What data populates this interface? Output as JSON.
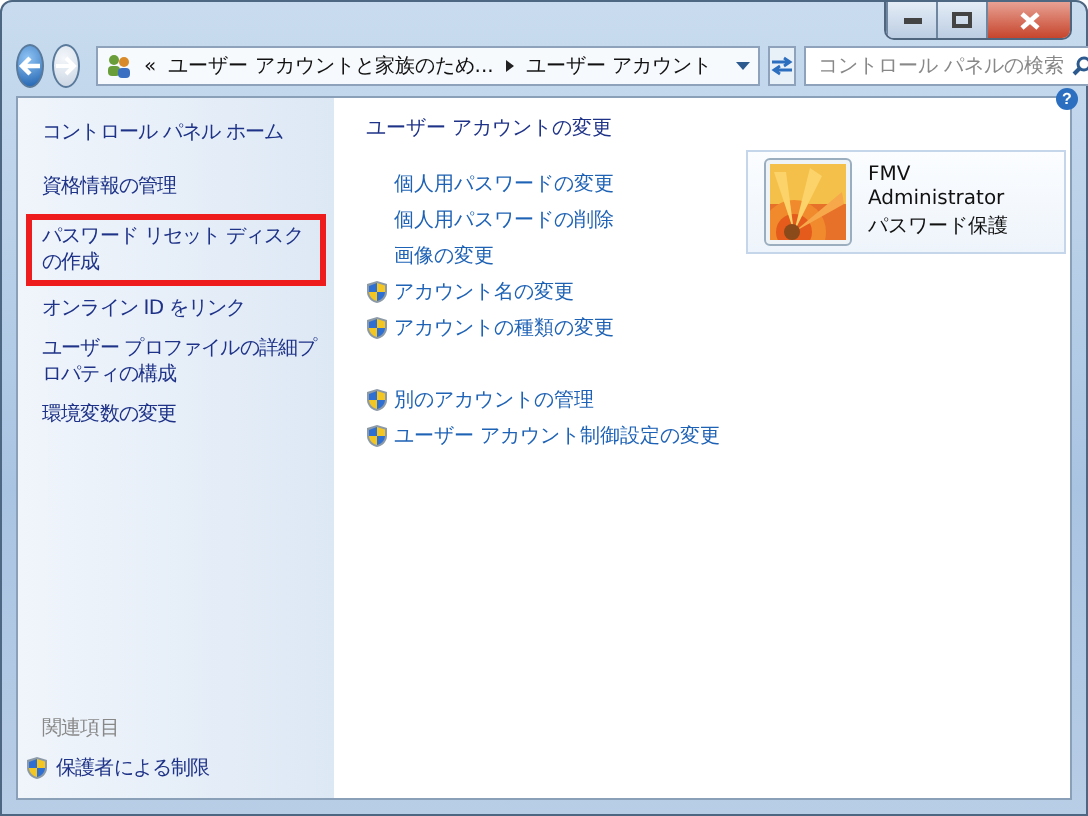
{
  "address_bar": {
    "prefix": "«",
    "crumbs": [
      "ユーザー アカウントと家族のため...",
      "ユーザー アカウント"
    ]
  },
  "search": {
    "placeholder": "コントロール パネルの検索"
  },
  "help": "?",
  "sidebar": {
    "home": "コントロール パネル ホーム",
    "links": [
      {
        "text": "資格情報の管理",
        "highlighted": false
      },
      {
        "text": "パスワード リセット ディスクの作成",
        "highlighted": true
      },
      {
        "text": "オンライン ID をリンク",
        "highlighted": false
      },
      {
        "text": "ユーザー プロファイルの詳細プロパティの構成",
        "highlighted": false
      },
      {
        "text": "環境変数の変更",
        "highlighted": false
      }
    ],
    "related_heading": "関連項目",
    "related_links": [
      {
        "text": "保護者による制限",
        "shield": true
      }
    ]
  },
  "main": {
    "heading": "ユーザー アカウントの変更",
    "task_groups": [
      [
        {
          "text": "個人用パスワードの変更",
          "shield": false
        },
        {
          "text": "個人用パスワードの削除",
          "shield": false
        },
        {
          "text": "画像の変更",
          "shield": false
        },
        {
          "text": "アカウント名の変更",
          "shield": true
        },
        {
          "text": "アカウントの種類の変更",
          "shield": true
        }
      ],
      [
        {
          "text": "別のアカウントの管理",
          "shield": true
        },
        {
          "text": "ユーザー アカウント制御設定の変更",
          "shield": true
        }
      ]
    ]
  },
  "account": {
    "name": "FMV",
    "role": "Administrator",
    "status": "パスワード保護"
  }
}
